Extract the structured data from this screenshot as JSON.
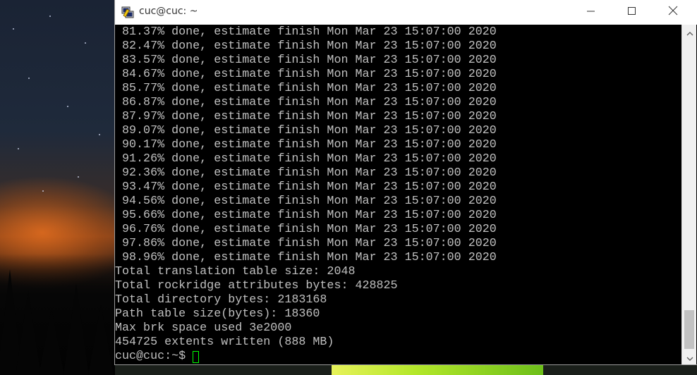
{
  "window": {
    "title": "cuc@cuc: ~",
    "controls": {
      "minimize": "minimize-icon",
      "maximize": "maximize-icon",
      "close": "close-icon"
    }
  },
  "terminal": {
    "lines": [
      " 81.37% done, estimate finish Mon Mar 23 15:07:00 2020",
      " 82.47% done, estimate finish Mon Mar 23 15:07:00 2020",
      " 83.57% done, estimate finish Mon Mar 23 15:07:00 2020",
      " 84.67% done, estimate finish Mon Mar 23 15:07:00 2020",
      " 85.77% done, estimate finish Mon Mar 23 15:07:00 2020",
      " 86.87% done, estimate finish Mon Mar 23 15:07:00 2020",
      " 87.97% done, estimate finish Mon Mar 23 15:07:00 2020",
      " 89.07% done, estimate finish Mon Mar 23 15:07:00 2020",
      " 90.17% done, estimate finish Mon Mar 23 15:07:00 2020",
      " 91.26% done, estimate finish Mon Mar 23 15:07:00 2020",
      " 92.36% done, estimate finish Mon Mar 23 15:07:00 2020",
      " 93.47% done, estimate finish Mon Mar 23 15:07:00 2020",
      " 94.56% done, estimate finish Mon Mar 23 15:07:00 2020",
      " 95.66% done, estimate finish Mon Mar 23 15:07:00 2020",
      " 96.76% done, estimate finish Mon Mar 23 15:07:00 2020",
      " 97.86% done, estimate finish Mon Mar 23 15:07:00 2020",
      " 98.96% done, estimate finish Mon Mar 23 15:07:00 2020",
      "Total translation table size: 2048",
      "Total rockridge attributes bytes: 428825",
      "Total directory bytes: 2183168",
      "Path table size(bytes): 18360",
      "Max brk space used 3e2000",
      "454725 extents written (888 MB)"
    ],
    "prompt": "cuc@cuc:~$",
    "colors": {
      "background": "#000000",
      "text": "#c0c0c0",
      "cursor": "#00ff00"
    }
  },
  "scrollbar": {
    "up_icon": "scroll-up-arrow-icon",
    "down_icon": "scroll-down-arrow-icon"
  }
}
